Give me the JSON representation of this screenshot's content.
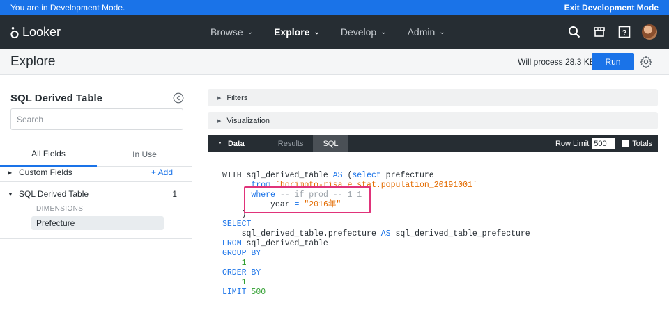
{
  "devbar": {
    "message": "You are in Development Mode.",
    "exit_label": "Exit Development Mode"
  },
  "nav": {
    "logo_text": "Looker",
    "items": [
      {
        "label": "Browse",
        "active": false
      },
      {
        "label": "Explore",
        "active": true
      },
      {
        "label": "Develop",
        "active": false
      },
      {
        "label": "Admin",
        "active": false
      }
    ],
    "icons": [
      "search-icon",
      "marketplace-icon",
      "help-icon",
      "avatar"
    ]
  },
  "header": {
    "title": "Explore",
    "process_text": "Will process 28.3 KB",
    "run_label": "Run"
  },
  "sidebar": {
    "title": "SQL Derived Table",
    "search_placeholder": "Search",
    "tabs": [
      "All Fields",
      "In Use"
    ],
    "custom_fields": {
      "label": "Custom Fields",
      "add_label": "+ Add"
    },
    "view": {
      "label": "SQL Derived Table",
      "count": "1"
    },
    "dimensions_label": "DIMENSIONS",
    "fields": [
      "Prefecture"
    ]
  },
  "main": {
    "filters_label": "Filters",
    "visualization_label": "Visualization",
    "data_label": "Data",
    "tabs": [
      "Results",
      "SQL"
    ],
    "row_limit_label": "Row Limit",
    "row_limit_value": "500",
    "totals_label": "Totals"
  },
  "sql": {
    "l1_a": "WITH sql_derived_table ",
    "l1_kw": "AS",
    "l1_b": " (",
    "l1_kw2": "select",
    "l1_c": " prefecture",
    "l2_kw": "from",
    "l2_str": "`horimoto-risa.e_stat.population_20191001`",
    "l3_kw": "where",
    "l3_cm": "-- if prod -- 1=1",
    "l4_a": "year ",
    "l4_op": "=",
    "l4_str": "\"2016年\"",
    "l5": ")",
    "l6_kw": "SELECT",
    "l7_a": "sql_derived_table.prefecture ",
    "l7_kw": "AS",
    "l7_b": " sql_derived_table_prefecture",
    "l8_kw": "FROM",
    "l8_a": " sql_derived_table",
    "l9_kw": "GROUP BY",
    "l10_num": "1",
    "l11_kw": "ORDER BY",
    "l12_num": "1",
    "l13_kw": "LIMIT",
    "l13_num": "500"
  }
}
